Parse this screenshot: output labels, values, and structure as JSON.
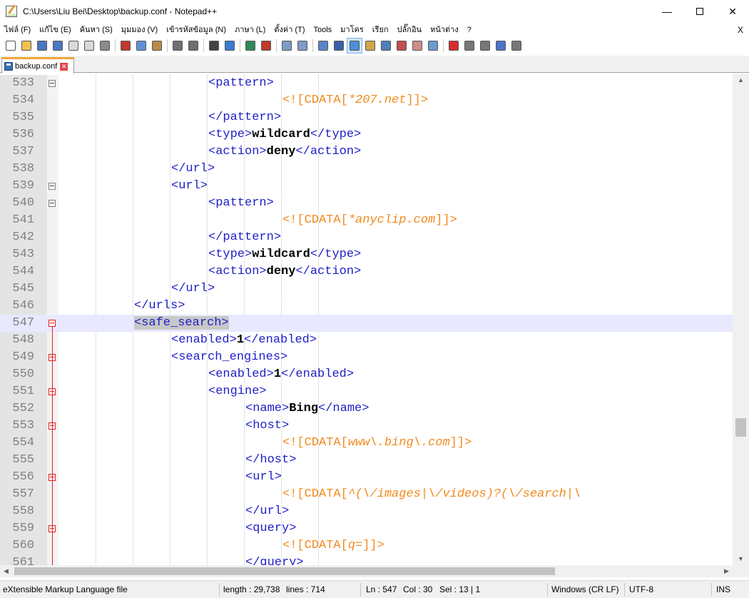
{
  "window": {
    "title": "C:\\Users\\Liu Bei\\Desktop\\backup.conf - Notepad++",
    "minimize": "—",
    "close": "✕"
  },
  "menu": {
    "items": [
      "ไฟล์ (F)",
      "แก้ไข (E)",
      "ค้นหา (S)",
      "มุมมอง (V)",
      "เข้ารหัสข้อมูล (N)",
      "ภาษา (L)",
      "ตั้งค่า (T)",
      "Tools",
      "มาโคร",
      "เรียก",
      "ปลั๊กอิน",
      "หน้าต่าง",
      "?"
    ],
    "close_x": "X"
  },
  "toolbar": {
    "icons": [
      "new-file-icon",
      "open-file-icon",
      "save-icon",
      "save-all-icon",
      "close-icon",
      "close-all-icon",
      "print-icon",
      "cut-icon",
      "copy-icon",
      "paste-icon",
      "undo-icon",
      "redo-icon",
      "find-icon",
      "replace-icon",
      "zoom-in-icon",
      "zoom-out-icon",
      "sync-vertical-icon",
      "sync-horizontal-icon",
      "word-wrap-icon",
      "show-all-chars-icon",
      "indent-guide-icon",
      "user-language-icon",
      "document-map-icon",
      "function-list-icon",
      "folder-workspace-icon",
      "monitoring-icon",
      "record-macro-icon",
      "stop-macro-icon",
      "play-macro-icon",
      "run-macro-multiple-icon",
      "save-macro-icon"
    ]
  },
  "tab": {
    "label": "backup.conf"
  },
  "editor": {
    "current_line": 547,
    "colors": {
      "tag": "#1e1ec8",
      "cdata": "#f28a1e",
      "text": "#000000",
      "line_number": "#808080",
      "current_line_bg": "#e8e8ff",
      "fold_marker": "#e02020"
    },
    "lines": [
      {
        "num": "533",
        "indent": 6,
        "fold": "box",
        "tokens": [
          [
            "t",
            "<pattern>"
          ]
        ]
      },
      {
        "num": "534",
        "indent": 8,
        "fold": "",
        "tokens": [
          [
            "c",
            "<![CDATA["
          ],
          [
            "ci",
            "*207.net"
          ],
          [
            "c",
            "]]>"
          ]
        ]
      },
      {
        "num": "535",
        "indent": 6,
        "fold": "",
        "tokens": [
          [
            "t",
            "</pattern>"
          ]
        ]
      },
      {
        "num": "536",
        "indent": 6,
        "fold": "",
        "tokens": [
          [
            "t",
            "<type>"
          ],
          [
            "x",
            "wildcard"
          ],
          [
            "t",
            "</type>"
          ]
        ]
      },
      {
        "num": "537",
        "indent": 6,
        "fold": "",
        "tokens": [
          [
            "t",
            "<action>"
          ],
          [
            "x",
            "deny"
          ],
          [
            "t",
            "</action>"
          ]
        ]
      },
      {
        "num": "538",
        "indent": 5,
        "fold": "",
        "tokens": [
          [
            "t",
            "</url>"
          ]
        ]
      },
      {
        "num": "539",
        "indent": 5,
        "fold": "box",
        "tokens": [
          [
            "t",
            "<url>"
          ]
        ]
      },
      {
        "num": "540",
        "indent": 6,
        "fold": "box",
        "tokens": [
          [
            "t",
            "<pattern>"
          ]
        ]
      },
      {
        "num": "541",
        "indent": 8,
        "fold": "",
        "tokens": [
          [
            "c",
            "<![CDATA["
          ],
          [
            "ci",
            "*anyclip.com"
          ],
          [
            "c",
            "]]>"
          ]
        ]
      },
      {
        "num": "542",
        "indent": 6,
        "fold": "",
        "tokens": [
          [
            "t",
            "</pattern>"
          ]
        ]
      },
      {
        "num": "543",
        "indent": 6,
        "fold": "",
        "tokens": [
          [
            "t",
            "<type>"
          ],
          [
            "x",
            "wildcard"
          ],
          [
            "t",
            "</type>"
          ]
        ]
      },
      {
        "num": "544",
        "indent": 6,
        "fold": "",
        "tokens": [
          [
            "t",
            "<action>"
          ],
          [
            "x",
            "deny"
          ],
          [
            "t",
            "</action>"
          ]
        ]
      },
      {
        "num": "545",
        "indent": 5,
        "fold": "",
        "tokens": [
          [
            "t",
            "</url>"
          ]
        ]
      },
      {
        "num": "546",
        "indent": 4,
        "fold": "",
        "tokens": [
          [
            "t",
            "</urls>"
          ]
        ]
      },
      {
        "num": "547",
        "indent": 4,
        "fold": "redbox",
        "tokens": [
          [
            "h",
            "<safe_search>"
          ]
        ]
      },
      {
        "num": "548",
        "indent": 5,
        "fold": "",
        "tokens": [
          [
            "t",
            "<enabled>"
          ],
          [
            "x",
            "1"
          ],
          [
            "t",
            "</enabled>"
          ]
        ]
      },
      {
        "num": "549",
        "indent": 5,
        "fold": "redbox",
        "tokens": [
          [
            "t",
            "<search_engines>"
          ]
        ]
      },
      {
        "num": "550",
        "indent": 6,
        "fold": "",
        "tokens": [
          [
            "t",
            "<enabled>"
          ],
          [
            "x",
            "1"
          ],
          [
            "t",
            "</enabled>"
          ]
        ]
      },
      {
        "num": "551",
        "indent": 6,
        "fold": "redbox",
        "tokens": [
          [
            "t",
            "<engine>"
          ]
        ]
      },
      {
        "num": "552",
        "indent": 7,
        "fold": "",
        "tokens": [
          [
            "t",
            "<name>"
          ],
          [
            "x",
            "Bing"
          ],
          [
            "t",
            "</name>"
          ]
        ]
      },
      {
        "num": "553",
        "indent": 7,
        "fold": "redbox",
        "tokens": [
          [
            "t",
            "<host>"
          ]
        ]
      },
      {
        "num": "554",
        "indent": 8,
        "fold": "",
        "tokens": [
          [
            "c",
            "<![CDATA["
          ],
          [
            "ci",
            "www\\.bing\\.com"
          ],
          [
            "c",
            "]]>"
          ]
        ]
      },
      {
        "num": "555",
        "indent": 7,
        "fold": "",
        "tokens": [
          [
            "t",
            "</host>"
          ]
        ]
      },
      {
        "num": "556",
        "indent": 7,
        "fold": "redbox",
        "tokens": [
          [
            "t",
            "<url>"
          ]
        ]
      },
      {
        "num": "557",
        "indent": 8,
        "fold": "",
        "tokens": [
          [
            "c",
            "<![CDATA["
          ],
          [
            "ci",
            "^(\\/images|\\/videos)?(\\/search|\\"
          ]
        ]
      },
      {
        "num": "558",
        "indent": 7,
        "fold": "",
        "tokens": [
          [
            "t",
            "</url>"
          ]
        ]
      },
      {
        "num": "559",
        "indent": 7,
        "fold": "redbox",
        "tokens": [
          [
            "t",
            "<query>"
          ]
        ]
      },
      {
        "num": "560",
        "indent": 8,
        "fold": "",
        "tokens": [
          [
            "c",
            "<![CDATA["
          ],
          [
            "ci",
            "q="
          ],
          [
            "c",
            "]]>"
          ]
        ]
      },
      {
        "num": "561",
        "indent": 7,
        "fold": "",
        "tokens": [
          [
            "t",
            "</query>"
          ]
        ]
      }
    ]
  },
  "scroll": {
    "vertical_position": 0.74
  },
  "status": {
    "file_type": "eXtensible Markup Language file",
    "length": "length : 29,738",
    "lines": "lines : 714",
    "ln": "Ln : 547",
    "col": "Col : 30",
    "sel": "Sel : 13 | 1",
    "eol": "Windows (CR LF)",
    "encoding": "UTF-8",
    "mode": "INS"
  }
}
